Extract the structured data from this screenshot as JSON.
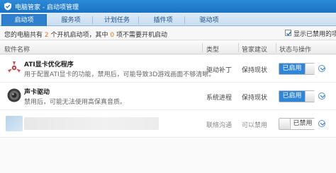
{
  "window": {
    "title": "电脑管家 - 启动项管理"
  },
  "tabs": [
    {
      "label": "启动项",
      "active": true
    },
    {
      "label": "服务项"
    },
    {
      "label": "计划任务"
    },
    {
      "label": "插件项"
    },
    {
      "label": "驱动项"
    }
  ],
  "summary": {
    "prefix": "您的电脑共有",
    "enabled_count": "2",
    "middle": "个开机启动项，其中",
    "skippable_count": "0",
    "suffix": "项不需要开机启动",
    "show_disabled_label": "显示已禁用的项",
    "show_disabled_checked": true
  },
  "columns": {
    "name": "软件名称",
    "type": "类型",
    "advice": "管家建议",
    "status": "状态与操作"
  },
  "rows": [
    {
      "name": "ATI显卡优化程序",
      "desc": "用于配置ATI显卡的功能，禁用后，可能导致3D游戏画面不够清晰。",
      "type": "驱动补丁",
      "advice": "保持现状",
      "status": "已启用",
      "icon": "ati-gpu-icon"
    },
    {
      "name": "声卡驱动",
      "desc": "禁用后，可能无法使用高保真音质。",
      "type": "系统进程",
      "advice": "保持现状",
      "status": "已启用",
      "icon": "speaker-icon"
    },
    {
      "name": "",
      "desc": "",
      "type": "联络沟通",
      "advice": "可以禁用",
      "status": "已禁用",
      "icon": "blurred-app-icon"
    }
  ],
  "colors": {
    "title_bar": "#1a73c4",
    "active_tab": "#2f7fcf",
    "enabled_toggle": "#2f86d9",
    "count_highlight": "#e07810"
  }
}
